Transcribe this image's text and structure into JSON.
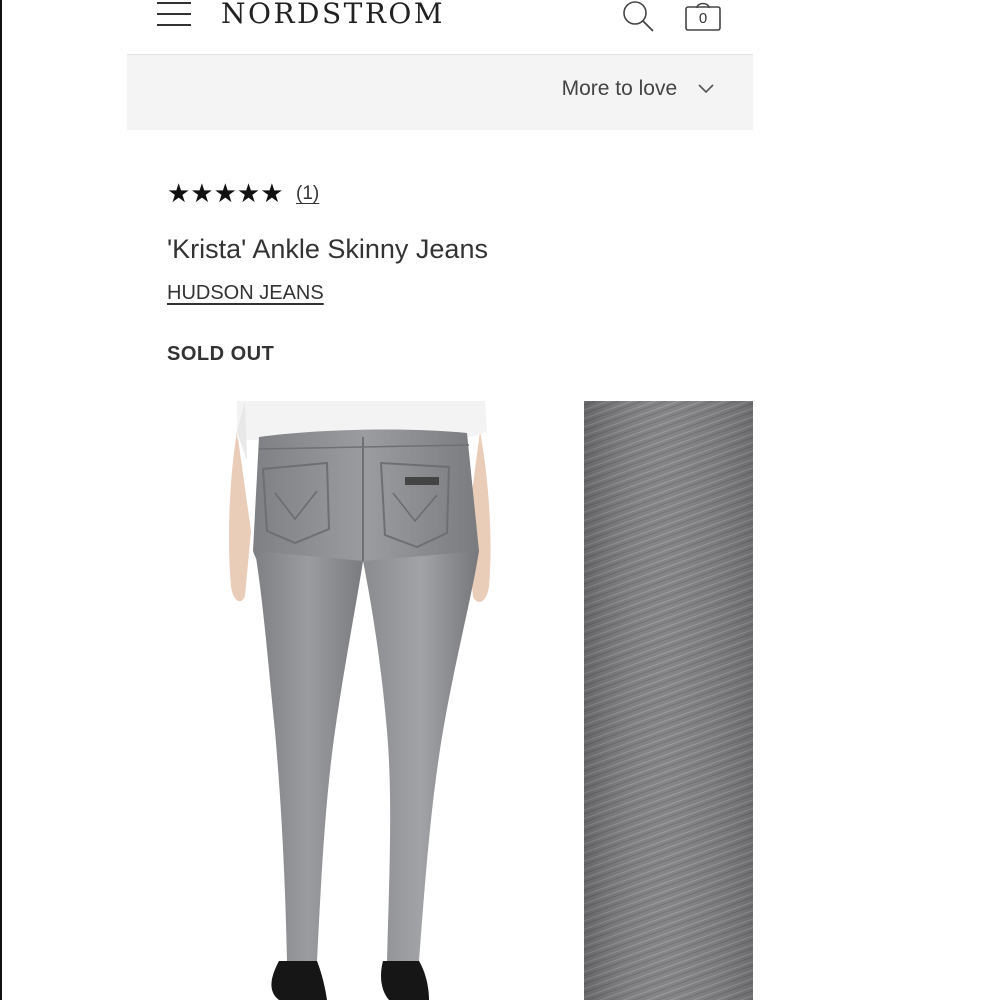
{
  "header": {
    "brand": "NORDSTROM",
    "bag_count": "0",
    "menu_icon": "hamburger-menu-icon",
    "search_icon": "search-icon",
    "bag_icon": "shopping-bag-icon"
  },
  "more_to_love": {
    "label": "More to love",
    "icon": "chevron-down-icon"
  },
  "product": {
    "stars": "★★★★★",
    "rating_value": 5,
    "rating_max": 5,
    "review_count": "(1)",
    "title": "'Krista' Ankle Skinny Jeans",
    "brand": "HUDSON JEANS",
    "status": "SOLD OUT"
  },
  "images": {
    "main_alt_icon": "product-photo",
    "swatch_color": "#7d7d7f"
  },
  "colors": {
    "more_bar_bg": "#f4f4f4",
    "denim_gray": "#8a8b8e"
  }
}
